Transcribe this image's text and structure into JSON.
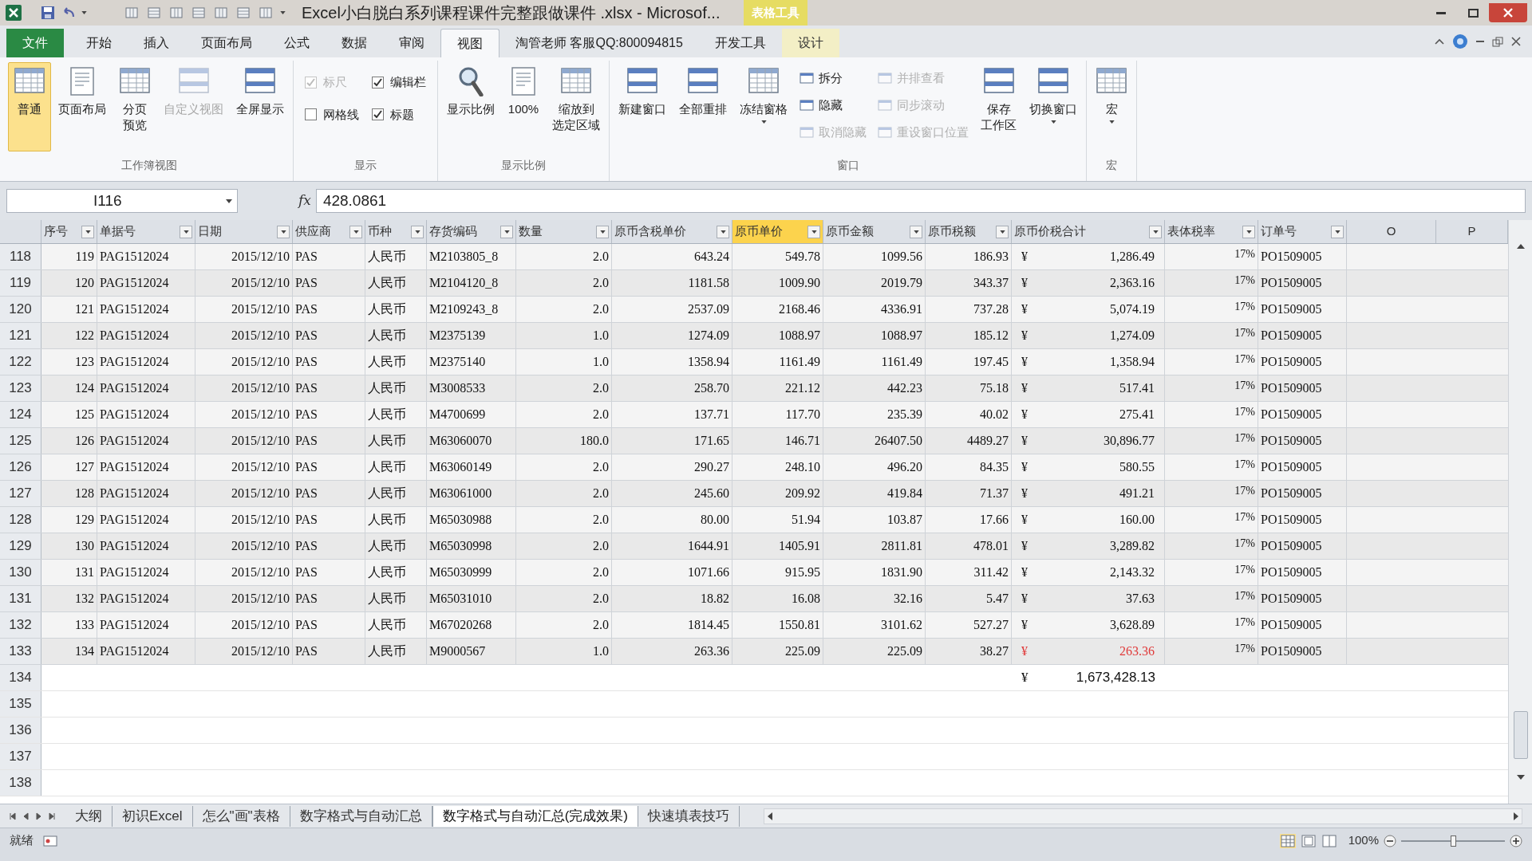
{
  "window": {
    "title": "Excel小白脱白系列课程课件完整跟做课件 .xlsx - Microsof...",
    "context_label": "表格工具"
  },
  "tabs": [
    {
      "label": "文件",
      "kind": "file",
      "selected": false
    },
    {
      "label": "开始",
      "kind": "normal",
      "selected": false
    },
    {
      "label": "插入",
      "kind": "normal",
      "selected": false
    },
    {
      "label": "页面布局",
      "kind": "normal",
      "selected": false
    },
    {
      "label": "公式",
      "kind": "normal",
      "selected": false
    },
    {
      "label": "数据",
      "kind": "normal",
      "selected": false
    },
    {
      "label": "审阅",
      "kind": "normal",
      "selected": false
    },
    {
      "label": "视图",
      "kind": "normal",
      "selected": true
    },
    {
      "label": "淘管老师 客服QQ:800094815",
      "kind": "normal",
      "selected": false
    },
    {
      "label": "开发工具",
      "kind": "normal",
      "selected": false
    },
    {
      "label": "设计",
      "kind": "context",
      "selected": false
    }
  ],
  "ribbon": {
    "groups": [
      {
        "label": "工作簿视图",
        "items": [
          {
            "kind": "large",
            "lines": [
              "普通"
            ],
            "selected": true,
            "disabled": false,
            "dropdown": false
          },
          {
            "kind": "large",
            "lines": [
              "页面布局"
            ],
            "selected": false,
            "disabled": false,
            "dropdown": false
          },
          {
            "kind": "large",
            "lines": [
              "分页",
              "预览"
            ],
            "selected": false,
            "disabled": false,
            "dropdown": false
          },
          {
            "kind": "large",
            "lines": [
              "自定义视图"
            ],
            "selected": false,
            "disabled": true,
            "dropdown": false
          },
          {
            "kind": "large",
            "lines": [
              "全屏显示"
            ],
            "selected": false,
            "disabled": false,
            "dropdown": false
          }
        ]
      },
      {
        "label": "显示",
        "items": [
          {
            "kind": "checkbox",
            "label": "标尺",
            "checked": true,
            "disabled": true
          },
          {
            "kind": "checkbox",
            "label": "编辑栏",
            "checked": true,
            "disabled": false
          },
          {
            "kind": "checkbox",
            "label": "网格线",
            "checked": false,
            "disabled": false
          },
          {
            "kind": "checkbox",
            "label": "标题",
            "checked": true,
            "disabled": false
          }
        ]
      },
      {
        "label": "显示比例",
        "items": [
          {
            "kind": "large",
            "lines": [
              "显示比例"
            ],
            "selected": false,
            "disabled": false,
            "dropdown": false
          },
          {
            "kind": "large",
            "lines": [
              "100%"
            ],
            "selected": false,
            "disabled": false,
            "dropdown": false
          },
          {
            "kind": "large",
            "lines": [
              "缩放到",
              "选定区域"
            ],
            "selected": false,
            "disabled": false,
            "dropdown": false
          }
        ]
      },
      {
        "label": "窗口",
        "items": [
          {
            "kind": "large",
            "lines": [
              "新建窗口"
            ],
            "selected": false,
            "disabled": false,
            "dropdown": false
          },
          {
            "kind": "large",
            "lines": [
              "全部重排"
            ],
            "selected": false,
            "disabled": false,
            "dropdown": false
          },
          {
            "kind": "large",
            "lines": [
              "冻结窗格"
            ],
            "selected": false,
            "disabled": false,
            "dropdown": true
          },
          {
            "kind": "small",
            "label": "拆分",
            "disabled": false
          },
          {
            "kind": "small",
            "label": "隐藏",
            "disabled": false
          },
          {
            "kind": "small",
            "label": "取消隐藏",
            "disabled": true
          },
          {
            "kind": "small",
            "label": "并排查看",
            "disabled": true
          },
          {
            "kind": "small",
            "label": "同步滚动",
            "disabled": true
          },
          {
            "kind": "small",
            "label": "重设窗口位置",
            "disabled": true
          },
          {
            "kind": "large",
            "lines": [
              "保存",
              "工作区"
            ],
            "selected": false,
            "disabled": false,
            "dropdown": false
          },
          {
            "kind": "large",
            "lines": [
              "切换窗口"
            ],
            "selected": false,
            "disabled": false,
            "dropdown": true
          }
        ]
      },
      {
        "label": "宏",
        "items": [
          {
            "kind": "large",
            "lines": [
              "宏"
            ],
            "selected": false,
            "disabled": false,
            "dropdown": true
          }
        ]
      }
    ]
  },
  "formula_bar": {
    "name_box": "I116",
    "fx": "fx",
    "value": "428.0861"
  },
  "table": {
    "columns": [
      {
        "label": "序号",
        "filter": true,
        "selected": false
      },
      {
        "label": "单据号",
        "filter": true,
        "selected": false
      },
      {
        "label": "日期",
        "filter": true,
        "selected": false
      },
      {
        "label": "供应商",
        "filter": true,
        "selected": false
      },
      {
        "label": "币种",
        "filter": true,
        "selected": false
      },
      {
        "label": "存货编码",
        "filter": true,
        "selected": false
      },
      {
        "label": "数量",
        "filter": true,
        "selected": false
      },
      {
        "label": "原币含税单价",
        "filter": true,
        "selected": false
      },
      {
        "label": "原币单价",
        "filter": true,
        "selected": true
      },
      {
        "label": "原币金额",
        "filter": true,
        "selected": false
      },
      {
        "label": "原币税额",
        "filter": true,
        "selected": false
      },
      {
        "label": "原币价税合计",
        "filter": true,
        "selected": false
      },
      {
        "label": "表体税率",
        "filter": true,
        "selected": false
      },
      {
        "label": "订单号",
        "filter": true,
        "selected": false
      },
      {
        "label": "O",
        "filter": false,
        "selected": false
      },
      {
        "label": "P",
        "filter": false,
        "selected": false
      }
    ],
    "rows": [
      {
        "row_number": "118",
        "cells": [
          "119",
          "PAG1512024",
          "2015/12/10",
          "PAS",
          "人民币",
          "M2103805_8",
          "2.0",
          "643.24",
          "549.78",
          "1099.56",
          "186.93",
          "1,286.49",
          "17%",
          "PO1509005"
        ],
        "currency_sign": "¥",
        "total_red": false
      },
      {
        "row_number": "119",
        "cells": [
          "120",
          "PAG1512024",
          "2015/12/10",
          "PAS",
          "人民币",
          "M2104120_8",
          "2.0",
          "1181.58",
          "1009.90",
          "2019.79",
          "343.37",
          "2,363.16",
          "17%",
          "PO1509005"
        ],
        "currency_sign": "¥",
        "total_red": false
      },
      {
        "row_number": "120",
        "cells": [
          "121",
          "PAG1512024",
          "2015/12/10",
          "PAS",
          "人民币",
          "M2109243_8",
          "2.0",
          "2537.09",
          "2168.46",
          "4336.91",
          "737.28",
          "5,074.19",
          "17%",
          "PO1509005"
        ],
        "currency_sign": "¥",
        "total_red": false
      },
      {
        "row_number": "121",
        "cells": [
          "122",
          "PAG1512024",
          "2015/12/10",
          "PAS",
          "人民币",
          "M2375139",
          "1.0",
          "1274.09",
          "1088.97",
          "1088.97",
          "185.12",
          "1,274.09",
          "17%",
          "PO1509005"
        ],
        "currency_sign": "¥",
        "total_red": false
      },
      {
        "row_number": "122",
        "cells": [
          "123",
          "PAG1512024",
          "2015/12/10",
          "PAS",
          "人民币",
          "M2375140",
          "1.0",
          "1358.94",
          "1161.49",
          "1161.49",
          "197.45",
          "1,358.94",
          "17%",
          "PO1509005"
        ],
        "currency_sign": "¥",
        "total_red": false
      },
      {
        "row_number": "123",
        "cells": [
          "124",
          "PAG1512024",
          "2015/12/10",
          "PAS",
          "人民币",
          "M3008533",
          "2.0",
          "258.70",
          "221.12",
          "442.23",
          "75.18",
          "517.41",
          "17%",
          "PO1509005"
        ],
        "currency_sign": "¥",
        "total_red": false
      },
      {
        "row_number": "124",
        "cells": [
          "125",
          "PAG1512024",
          "2015/12/10",
          "PAS",
          "人民币",
          "M4700699",
          "2.0",
          "137.71",
          "117.70",
          "235.39",
          "40.02",
          "275.41",
          "17%",
          "PO1509005"
        ],
        "currency_sign": "¥",
        "total_red": false
      },
      {
        "row_number": "125",
        "cells": [
          "126",
          "PAG1512024",
          "2015/12/10",
          "PAS",
          "人民币",
          "M63060070",
          "180.0",
          "171.65",
          "146.71",
          "26407.50",
          "4489.27",
          "30,896.77",
          "17%",
          "PO1509005"
        ],
        "currency_sign": "¥",
        "total_red": false
      },
      {
        "row_number": "126",
        "cells": [
          "127",
          "PAG1512024",
          "2015/12/10",
          "PAS",
          "人民币",
          "M63060149",
          "2.0",
          "290.27",
          "248.10",
          "496.20",
          "84.35",
          "580.55",
          "17%",
          "PO1509005"
        ],
        "currency_sign": "¥",
        "total_red": false
      },
      {
        "row_number": "127",
        "cells": [
          "128",
          "PAG1512024",
          "2015/12/10",
          "PAS",
          "人民币",
          "M63061000",
          "2.0",
          "245.60",
          "209.92",
          "419.84",
          "71.37",
          "491.21",
          "17%",
          "PO1509005"
        ],
        "currency_sign": "¥",
        "total_red": false
      },
      {
        "row_number": "128",
        "cells": [
          "129",
          "PAG1512024",
          "2015/12/10",
          "PAS",
          "人民币",
          "M65030988",
          "2.0",
          "80.00",
          "51.94",
          "103.87",
          "17.66",
          "160.00",
          "17%",
          "PO1509005"
        ],
        "currency_sign": "¥",
        "total_red": false
      },
      {
        "row_number": "129",
        "cells": [
          "130",
          "PAG1512024",
          "2015/12/10",
          "PAS",
          "人民币",
          "M65030998",
          "2.0",
          "1644.91",
          "1405.91",
          "2811.81",
          "478.01",
          "3,289.82",
          "17%",
          "PO1509005"
        ],
        "currency_sign": "¥",
        "total_red": false
      },
      {
        "row_number": "130",
        "cells": [
          "131",
          "PAG1512024",
          "2015/12/10",
          "PAS",
          "人民币",
          "M65030999",
          "2.0",
          "1071.66",
          "915.95",
          "1831.90",
          "311.42",
          "2,143.32",
          "17%",
          "PO1509005"
        ],
        "currency_sign": "¥",
        "total_red": false
      },
      {
        "row_number": "131",
        "cells": [
          "132",
          "PAG1512024",
          "2015/12/10",
          "PAS",
          "人民币",
          "M65031010",
          "2.0",
          "18.82",
          "16.08",
          "32.16",
          "5.47",
          "37.63",
          "17%",
          "PO1509005"
        ],
        "currency_sign": "¥",
        "total_red": false
      },
      {
        "row_number": "132",
        "cells": [
          "133",
          "PAG1512024",
          "2015/12/10",
          "PAS",
          "人民币",
          "M67020268",
          "2.0",
          "1814.45",
          "1550.81",
          "3101.62",
          "527.27",
          "3,628.89",
          "17%",
          "PO1509005"
        ],
        "currency_sign": "¥",
        "total_red": false
      },
      {
        "row_number": "133",
        "cells": [
          "134",
          "PAG1512024",
          "2015/12/10",
          "PAS",
          "人民币",
          "M9000567",
          "1.0",
          "263.36",
          "225.09",
          "225.09",
          "38.27",
          "263.36",
          "17%",
          "PO1509005"
        ],
        "currency_sign": "¥",
        "total_red": true
      }
    ],
    "grand_total": {
      "row_number": "134",
      "currency_sign": "¥",
      "value": "1,673,428.13"
    },
    "empty_rows": [
      "135",
      "136",
      "137",
      "138"
    ]
  },
  "sheet_tabs": [
    {
      "label": "大纲",
      "selected": false
    },
    {
      "label": "初识Excel",
      "selected": false
    },
    {
      "label": "怎么\"画\"表格",
      "selected": false
    },
    {
      "label": "数字格式与自动汇总",
      "selected": false
    },
    {
      "label": "数字格式与自动汇总(完成效果)",
      "selected": true
    },
    {
      "label": "快速填表技巧",
      "selected": false
    }
  ],
  "status_bar": {
    "status": "就绪",
    "zoom": "100%",
    "zoom_slider": {
      "level": 0.5
    }
  }
}
